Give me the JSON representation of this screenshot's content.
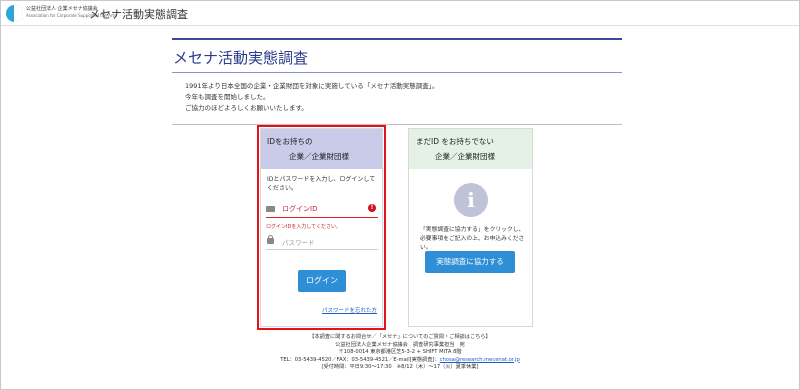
{
  "topbar": {
    "org_name_jp": "公益社団法人 企業メセナ協議会",
    "org_name_en": "Association for Corporate Support of the Arts",
    "title": "メセナ活動実態調査"
  },
  "page": {
    "title": "メセナ活動実態調査",
    "intro": [
      "1991年より日本全国の企業・企業財団を対象に実施している「メセナ活動実態調査」。",
      "今年も調査を開始しました。",
      "ご協力のほどよろしくお願いいたします。"
    ]
  },
  "login_card": {
    "heading_line1": "IDをお持ちの",
    "heading_line2": "企業／企業財団様",
    "description": "IDとパスワードを入力し、ログインしてください。",
    "id_placeholder": "ログインID",
    "id_error": "ログインIDを入力してください。",
    "password_placeholder": "パスワード",
    "login_button": "ログイン",
    "forgot_link": "パスワードを忘れた方"
  },
  "new_card": {
    "heading_line1": "まだID をお持ちでない",
    "heading_line2": "企業／企業財団様",
    "info_glyph": "i",
    "description": "「実態調査に協力する」をクリックし、必要事項をご記入の上、お申込みください。",
    "cooperate_button": "実態調査に協力する"
  },
  "footer": {
    "line1": "【本調査に関するお問合せ／「メセナ」についてのご質問・ご相談はこちら】",
    "line2": "公益社団法人企業メセナ協議会　調査研究事業担当　宛",
    "line3": "〒108-0014 東京都港区芝5-3-2 + SHIFT MITA 8階",
    "line4_prefix": "TEL：03-5439-4520／FAX：03-5439-4521／E-mail[実態調査]：",
    "email": "chosa@research.mecenat.or.jp",
    "line5": "[受付時間：平日9:30～17:30　※8/12（木）～17（火）夏季休業]"
  },
  "colors": {
    "accent_blue": "#2f8fd6",
    "title_navy": "#2b3a8c",
    "error_red": "#c3232a",
    "login_header": "#c9cbe8",
    "new_header": "#e6f1e6"
  },
  "icons": [
    "mecenat-logo",
    "id-card-icon",
    "error-icon",
    "lock-icon",
    "info-icon"
  ]
}
